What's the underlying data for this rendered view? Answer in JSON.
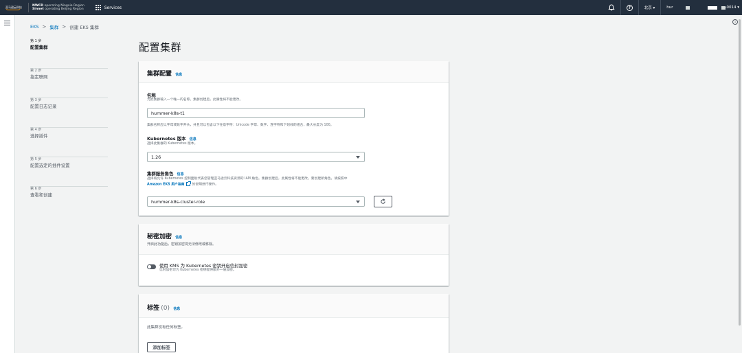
{
  "topbar": {
    "logo_text": "亚马逊云科技",
    "region_line1_bold": "NWCD",
    "region_line1": "operating Ningxia Region",
    "region_line2_bold": "Sinnet",
    "region_line2": "operating Beijing Region",
    "services_label": "Services",
    "region_label": "北京 ▾",
    "user_prefix": "hur",
    "account_suffix": "-0014 ▾"
  },
  "breadcrumb": {
    "eks": "EKS",
    "clusters": "集群",
    "current": "创建 EKS 集群"
  },
  "steps": [
    {
      "num": "第 1 步",
      "name": "配置集群",
      "active": true
    },
    {
      "num": "第 2 步",
      "name": "指定联网",
      "active": false
    },
    {
      "num": "第 3 步",
      "name": "配置日志记录",
      "active": false
    },
    {
      "num": "第 4 步",
      "name": "选择插件",
      "active": false
    },
    {
      "num": "第 5 步",
      "name": "配置选定的插件设置",
      "active": false
    },
    {
      "num": "第 6 步",
      "name": "查看和创建",
      "active": false
    }
  ],
  "page_title": "配置集群",
  "cluster_config": {
    "title": "集群配置",
    "info": "信息",
    "name_label": "名称",
    "name_desc": "为此集群输入一个唯一的名称。集群创建后，此属性将不能更改。",
    "name_value": "hummer-k8s-t1",
    "name_constraint": "集群名称应以字母或数字开头，并且可以包含以下任意字符：Unicode 字母、数字、连字符和下划线的组合，最大长度为 100。",
    "version_label": "Kubernetes 版本",
    "version_info": "信息",
    "version_desc": "选择此集群的 Kubernetes 版本。",
    "version_value": "1.26",
    "role_label": "集群服务角色",
    "role_info": "信息",
    "role_desc": "选择将允许 Kubernetes 控制面板代表您管理亚马逊云科技资源的 IAM 角色。集群创建后，此属性将不能更改。要创建新角色，请按照中",
    "role_desc_link": "Amazon EKS 用户指南",
    "role_desc_tail": "的说明进行操作。",
    "role_value": "hummer-k8s-cluster-role"
  },
  "secrets": {
    "title": "秘密加密",
    "info": "信息",
    "desc": "开启此功能后，密钥加密将无法修改或移除。",
    "toggle_label": "使用 KMS 为 Kubernetes 密钥开启信封加密",
    "toggle_desc": "信封加密可为 Kubernetes 密钥提供额外一层加密。",
    "toggle_on": false
  },
  "tags": {
    "title": "标签",
    "count": "(0)",
    "info": "信息",
    "empty": "此集群没有任何标签。",
    "add_button": "添加标签"
  }
}
